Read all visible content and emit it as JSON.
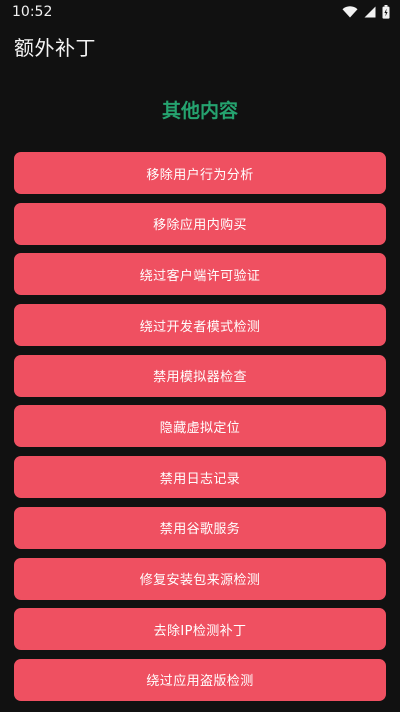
{
  "status_bar": {
    "time": "10:52",
    "icons": [
      "wifi-icon",
      "signal-icon",
      "battery-icon"
    ]
  },
  "app_bar": {
    "title": "额外补丁"
  },
  "section": {
    "title": "其他内容"
  },
  "buttons": [
    {
      "label": "移除用户行为分析"
    },
    {
      "label": "移除应用内购买"
    },
    {
      "label": "绕过客户端许可验证"
    },
    {
      "label": "绕过开发者模式检测"
    },
    {
      "label": "禁用模拟器检查"
    },
    {
      "label": "隐藏虚拟定位"
    },
    {
      "label": "禁用日志记录"
    },
    {
      "label": "禁用谷歌服务"
    },
    {
      "label": "修复安装包来源检测"
    },
    {
      "label": "去除IP检测补丁"
    },
    {
      "label": "绕过应用盗版检测"
    }
  ],
  "colors": {
    "background": "#111111",
    "button": "#ef5061",
    "section_title": "#25a36f",
    "text": "#ffffff"
  }
}
